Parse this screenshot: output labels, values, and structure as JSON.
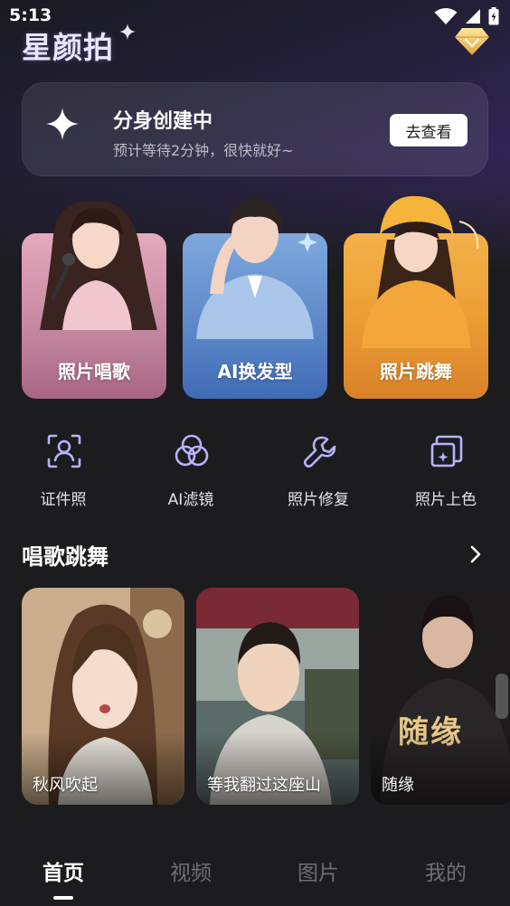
{
  "status_bar": {
    "time": "5:13",
    "icons": [
      "wifi-icon",
      "signal-icon",
      "battery-icon"
    ]
  },
  "header": {
    "app_name": "星颜拍",
    "vip_icon": "diamond-icon"
  },
  "creating_card": {
    "icon": "sparkle-icon",
    "title": "分身创建中",
    "subtitle": "预计等待2分钟，很快就好~",
    "button_label": "去查看"
  },
  "feature_cards": [
    {
      "label": "照片唱歌",
      "color": "#c58aa1"
    },
    {
      "label": "AI换发型",
      "color": "#5b86c8"
    },
    {
      "label": "照片跳舞",
      "color": "#ea9c33"
    }
  ],
  "tools": [
    {
      "label": "证件照",
      "icon": "id-photo-icon"
    },
    {
      "label": "AI滤镜",
      "icon": "filter-icon"
    },
    {
      "label": "照片修复",
      "icon": "wrench-icon"
    },
    {
      "label": "照片上色",
      "icon": "colorize-icon"
    }
  ],
  "section": {
    "title": "唱歌跳舞",
    "more_icon": "chevron-right-icon"
  },
  "videos": [
    {
      "title": "秋风吹起"
    },
    {
      "title": "等我翻过这座山"
    },
    {
      "title": "随缘",
      "poster_text": "随缘"
    }
  ],
  "bottom_nav": {
    "items": [
      {
        "label": "首页",
        "active": true
      },
      {
        "label": "视频",
        "active": false
      },
      {
        "label": "图片",
        "active": false
      },
      {
        "label": "我的",
        "active": false
      }
    ]
  },
  "colors": {
    "background": "#1c1c1e",
    "accent_purple": "#3b2a6e",
    "inactive_text": "#6e6e74"
  }
}
